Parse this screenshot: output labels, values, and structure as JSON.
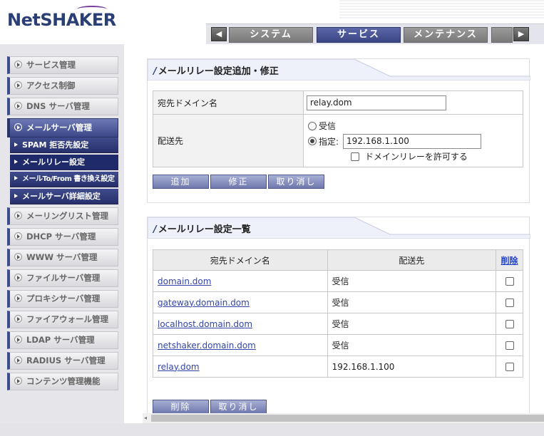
{
  "app": {
    "logo": "NetSHAKER"
  },
  "tabs": {
    "prev_icon": "◀",
    "next_icon": "▶",
    "items": [
      {
        "label": "システム"
      },
      {
        "label": "サービス"
      },
      {
        "label": "メンテナンス"
      }
    ]
  },
  "sidebar": {
    "items": [
      {
        "label": "サービス管理"
      },
      {
        "label": "アクセス制御"
      },
      {
        "label": "DNS サーバ管理"
      },
      {
        "label": "メールサーバ管理"
      },
      {
        "label": "メーリングリスト管理"
      },
      {
        "label": "DHCP サーバ管理"
      },
      {
        "label": "WWW サーバ管理"
      },
      {
        "label": "ファイルサーバ管理"
      },
      {
        "label": "プロキシサーバ管理"
      },
      {
        "label": "ファイアウォール管理"
      },
      {
        "label": "LDAP サーバ管理"
      },
      {
        "label": "RADIUS サーバ管理"
      },
      {
        "label": "コンテンツ管理機能"
      }
    ],
    "sub_items": [
      {
        "label": "SPAM 拒否先設定"
      },
      {
        "label": "メールリレー設定"
      },
      {
        "label": "メールTo/From 書き換え設定"
      },
      {
        "label": "メールサーバ詳細設定"
      }
    ]
  },
  "form_panel": {
    "title": "メールリレー設定追加・修正",
    "domain_label": "宛先ドメイン名",
    "domain_value": "relay.dom",
    "dest_label": "配送先",
    "radio_receive": "受信",
    "radio_specify": "指定:",
    "specify_value": "192.168.1.100",
    "allow_domain_relay": "ドメインリレーを許可する",
    "buttons": {
      "add": "追加",
      "modify": "修正",
      "cancel": "取り消し"
    }
  },
  "list_panel": {
    "title": "メールリレー設定一覧",
    "columns": [
      "宛先ドメイン名",
      "配送先",
      "削除"
    ],
    "rows": [
      {
        "domain": "domain.dom",
        "dest": "受信"
      },
      {
        "domain": "gateway.domain.dom",
        "dest": "受信"
      },
      {
        "domain": "localhost.domain.dom",
        "dest": "受信"
      },
      {
        "domain": "netshaker.domain.dom",
        "dest": "受信"
      },
      {
        "domain": "relay.dom",
        "dest": "192.168.1.100"
      }
    ],
    "buttons": {
      "delete": "削除",
      "cancel": "取り消し"
    }
  },
  "colors": {
    "brand": "#2b3f77",
    "active_tab": "#3a4584",
    "link": "#3344aa"
  }
}
